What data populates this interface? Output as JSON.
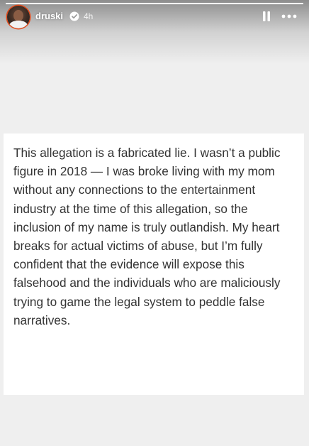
{
  "story": {
    "username": "druski",
    "verified": true,
    "time_ago": "4h",
    "progress": 1.0,
    "avatar_ring_color": "#e64a19",
    "icons": {
      "avatar": "user-avatar",
      "verified": "verified-badge-icon",
      "pause": "pause-icon",
      "more": "more-options-icon"
    }
  },
  "statement": {
    "text": "This allegation is a fabricated lie. I wasn’t a public figure in 2018 — I was broke living with my mom without any connections to the entertainment industry at the time of this allegation, so the inclusion of my name is truly outlandish. My heart breaks for actual victims of abuse, but I’m fully confident that the evidence will expose this falsehood and the individuals who are maliciously trying to game the legal system to peddle false narratives."
  }
}
